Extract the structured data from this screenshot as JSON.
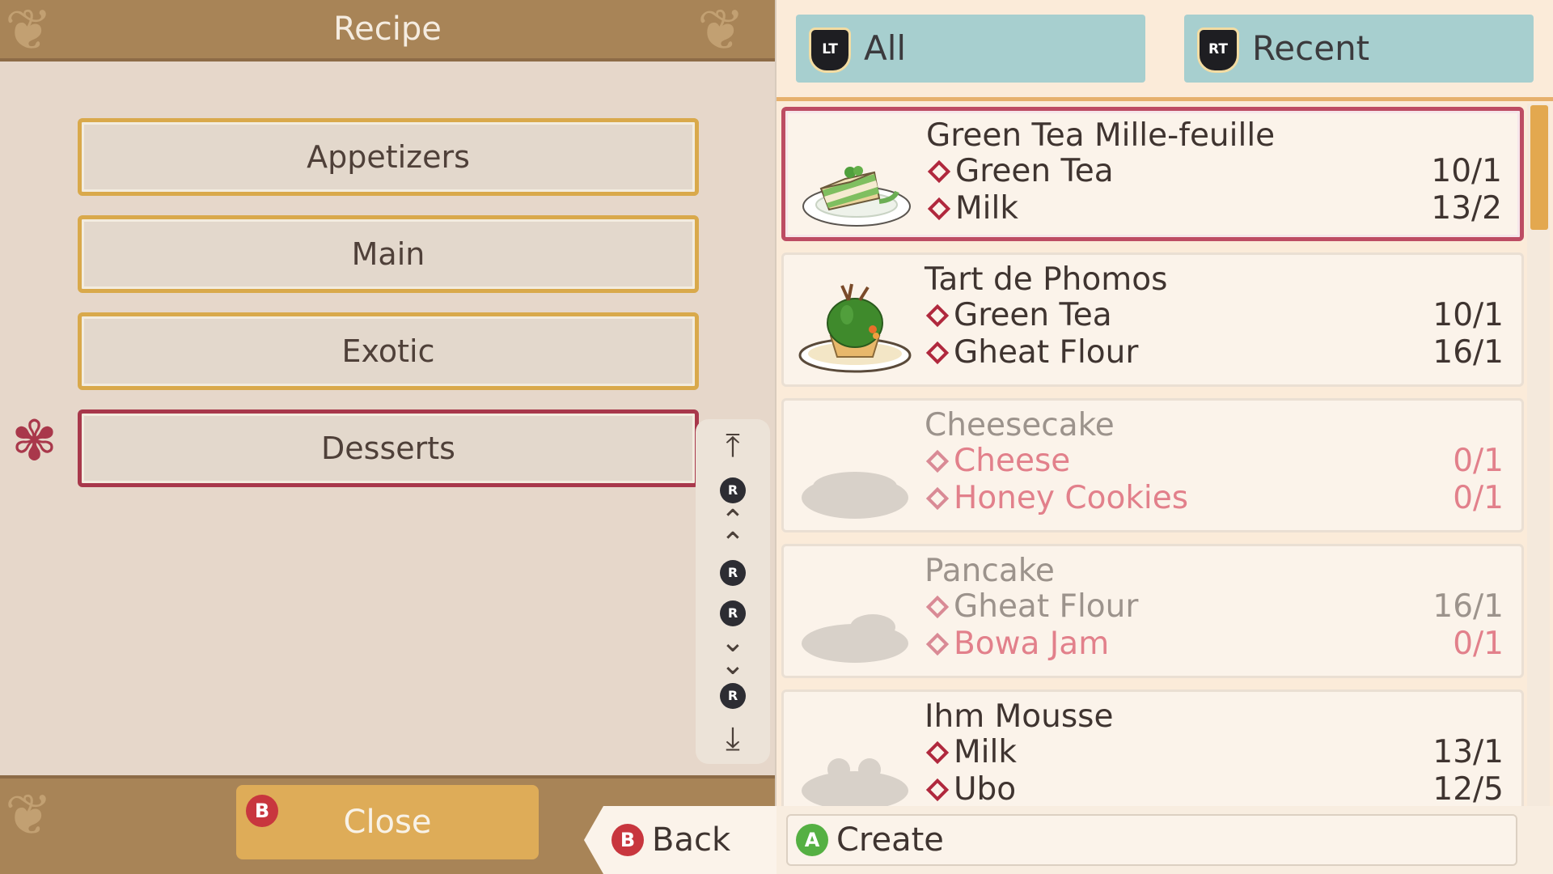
{
  "header": {
    "title": "Recipe"
  },
  "categories": [
    {
      "label": "Appetizers",
      "selected": false
    },
    {
      "label": "Main",
      "selected": false
    },
    {
      "label": "Exotic",
      "selected": false
    },
    {
      "label": "Desserts",
      "selected": true
    }
  ],
  "scroll_nav": {
    "button_letter": "R"
  },
  "close_button": {
    "badge": "B",
    "label": "Close"
  },
  "filters": [
    {
      "badge": "LT",
      "label": "All"
    },
    {
      "badge": "RT",
      "label": "Recent"
    }
  ],
  "recipes": [
    {
      "name": "Green Tea Mille-feuille",
      "selected": true,
      "locked": false,
      "ingredients": [
        {
          "name": "Green Tea",
          "qty": "10/1",
          "missing": false
        },
        {
          "name": "Milk",
          "qty": "13/2",
          "missing": false
        }
      ]
    },
    {
      "name": "Tart de Phomos",
      "selected": false,
      "locked": false,
      "ingredients": [
        {
          "name": "Green Tea",
          "qty": "10/1",
          "missing": false
        },
        {
          "name": "Gheat Flour",
          "qty": "16/1",
          "missing": false
        }
      ]
    },
    {
      "name": "Cheesecake",
      "selected": false,
      "locked": true,
      "ingredients": [
        {
          "name": "Cheese",
          "qty": "0/1",
          "missing": true
        },
        {
          "name": "Honey Cookies",
          "qty": "0/1",
          "missing": true
        }
      ]
    },
    {
      "name": "Pancake",
      "selected": false,
      "locked": true,
      "ingredients": [
        {
          "name": "Gheat Flour",
          "qty": "16/1",
          "missing": false
        },
        {
          "name": "Bowa Jam",
          "qty": "0/1",
          "missing": true
        }
      ]
    },
    {
      "name": "Ihm Mousse",
      "selected": false,
      "locked": false,
      "ingredients": [
        {
          "name": "Milk",
          "qty": "13/1",
          "missing": false
        },
        {
          "name": "Ubo",
          "qty": "12/5",
          "missing": false
        }
      ]
    }
  ],
  "back_button": {
    "badge": "B",
    "label": "Back"
  },
  "create_button": {
    "badge": "A",
    "label": "Create"
  },
  "colors": {
    "accent_selected": "#bd4c63",
    "missing_text": "#e2808b",
    "tab_bg": "#a7cfcf",
    "gold_border": "#d9a94b"
  }
}
